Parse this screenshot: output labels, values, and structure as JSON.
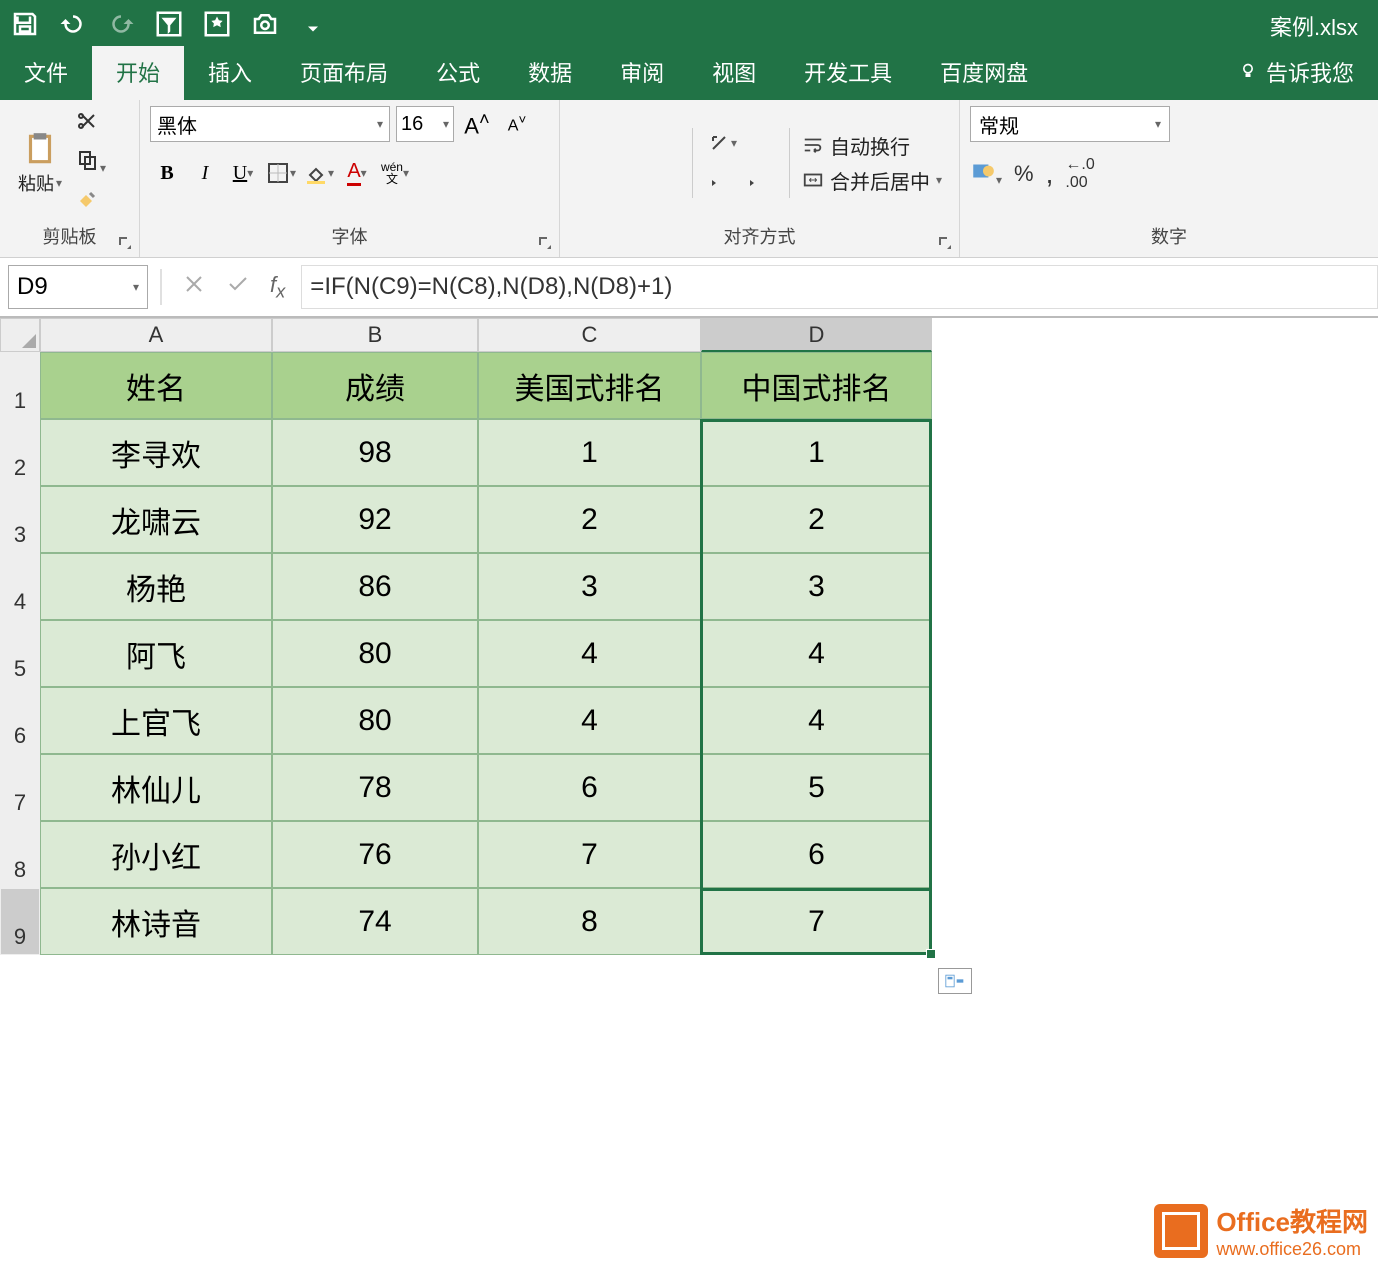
{
  "app": {
    "filename": "案例.xlsx"
  },
  "tabs": {
    "file": "文件",
    "home": "开始",
    "insert": "插入",
    "layout": "页面布局",
    "formula": "公式",
    "data": "数据",
    "review": "审阅",
    "view": "视图",
    "dev": "开发工具",
    "baidu": "百度网盘",
    "tellme": "告诉我您"
  },
  "ribbon": {
    "clipboard": {
      "paste": "粘贴",
      "group": "剪贴板"
    },
    "font": {
      "name": "黑体",
      "size": "16",
      "group": "字体",
      "ruby": "wén",
      "ruby2": "文"
    },
    "align": {
      "group": "对齐方式",
      "wrap": "自动换行",
      "merge": "合并后居中"
    },
    "number": {
      "group": "数字",
      "format": "常规",
      "percent": "%",
      "comma": ","
    }
  },
  "formula_bar": {
    "cellref": "D9",
    "formula": "=IF(N(C9)=N(C8),N(D8),N(D8)+1)"
  },
  "sheet": {
    "cols": [
      "A",
      "B",
      "C",
      "D"
    ],
    "rows": [
      "1",
      "2",
      "3",
      "4",
      "5",
      "6",
      "7",
      "8",
      "9"
    ],
    "headers": [
      "姓名",
      "成绩",
      "美国式排名",
      "中国式排名"
    ],
    "data": [
      {
        "name": "李寻欢",
        "score": "98",
        "us": "1",
        "cn": "1"
      },
      {
        "name": "龙啸云",
        "score": "92",
        "us": "2",
        "cn": "2"
      },
      {
        "name": "杨艳",
        "score": "86",
        "us": "3",
        "cn": "3"
      },
      {
        "name": "阿飞",
        "score": "80",
        "us": "4",
        "cn": "4"
      },
      {
        "name": "上官飞",
        "score": "80",
        "us": "4",
        "cn": "4"
      },
      {
        "name": "林仙儿",
        "score": "78",
        "us": "6",
        "cn": "5"
      },
      {
        "name": "孙小红",
        "score": "76",
        "us": "7",
        "cn": "6"
      },
      {
        "name": "林诗音",
        "score": "74",
        "us": "8",
        "cn": "7"
      }
    ]
  },
  "watermark": {
    "title": "Office教程网",
    "url": "www.office26.com"
  },
  "icons": {
    "B": "B",
    "I": "I",
    "U": "U",
    "Aplus": "A",
    "Aminus": "A",
    "dec": ".0"
  }
}
